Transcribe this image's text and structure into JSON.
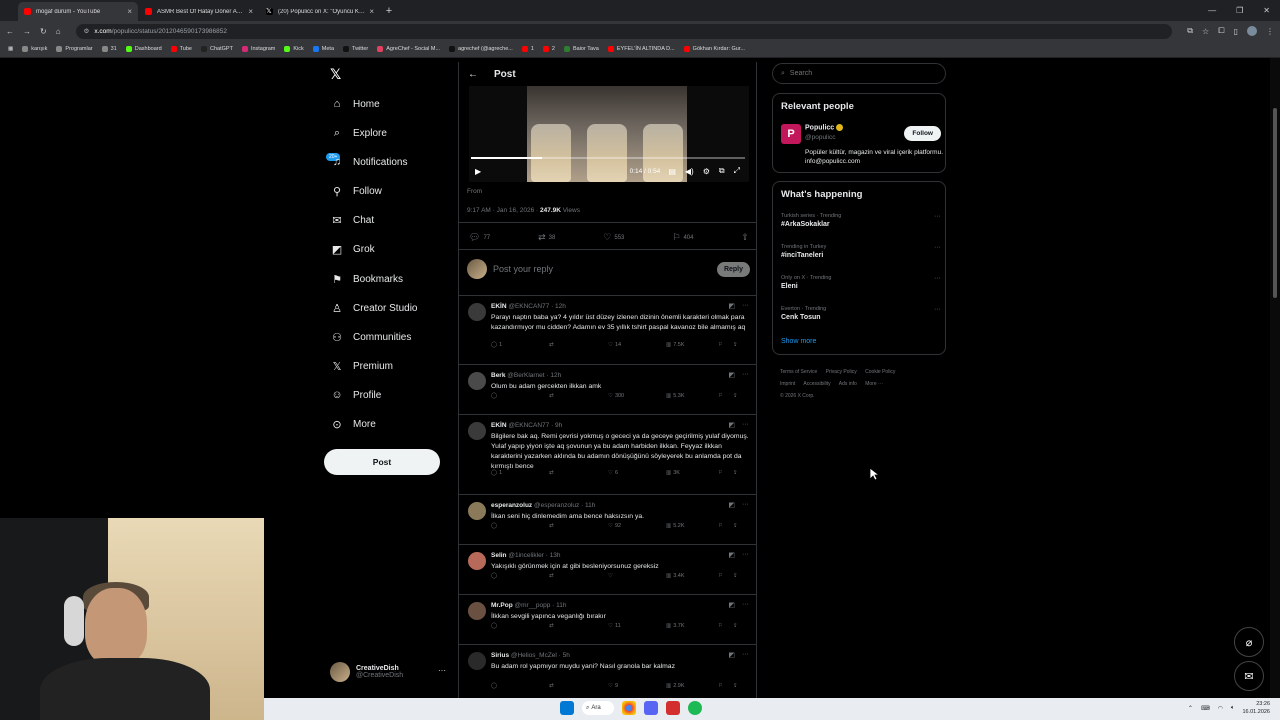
{
  "browser": {
    "tabs": [
      {
        "title": "mogaf dürüm - YouTube",
        "icon": "youtube-icon",
        "color": "#ff0000"
      },
      {
        "title": "ASMR Best Of Hatay Döner Ac...",
        "icon": "youtube-icon",
        "color": "#ff0000"
      },
      {
        "title": "(20) Populicc on X: \"Oyuncu Kı...",
        "icon": "x-icon",
        "color": "#ffffff"
      }
    ],
    "url_main": "x.com",
    "url_rest": "/populicc/status/2012046590173986852",
    "bookmarks": [
      "karışık",
      "Programlar",
      "31",
      "Dashboard",
      "Tube",
      "ChatGPT",
      "Instagram",
      "Kick",
      "Meta",
      "Twitter",
      "AgreChef - Social M...",
      "agrechef (@agreche...",
      "1",
      "2",
      "Baior Tava",
      "EYFEL'İN ALTINDA D...",
      "Gökhan Kırdar: Gur..."
    ]
  },
  "nav": {
    "items": [
      {
        "label": "Home",
        "icon": "home-icon",
        "glyph": "⌂"
      },
      {
        "label": "Explore",
        "icon": "search-icon",
        "glyph": "⌕"
      },
      {
        "label": "Notifications",
        "icon": "bell-icon",
        "glyph": "🔔"
      },
      {
        "label": "Follow",
        "icon": "add-person-icon",
        "glyph": "👤"
      },
      {
        "label": "Chat",
        "icon": "mail-icon",
        "glyph": "✉"
      },
      {
        "label": "Grok",
        "icon": "grok-icon",
        "glyph": "◩"
      },
      {
        "label": "Bookmarks",
        "icon": "bookmark-icon",
        "glyph": "⚑"
      },
      {
        "label": "Creator Studio",
        "icon": "creator-studio-icon",
        "glyph": "♙"
      },
      {
        "label": "Communities",
        "icon": "communities-icon",
        "glyph": "👥"
      },
      {
        "label": "Premium",
        "icon": "x-premium-icon",
        "glyph": "𝕏"
      },
      {
        "label": "Profile",
        "icon": "profile-icon",
        "glyph": "👤"
      },
      {
        "label": "More",
        "icon": "more-circle-icon",
        "glyph": "⋯"
      }
    ],
    "badge": "20+",
    "post_label": "Post",
    "account_name": "CreativeDish",
    "account_handle": "@CreativeDish"
  },
  "post": {
    "header": "Post",
    "video_time": "0:14 / 0:54",
    "video_progress": 0.26,
    "from": "From",
    "time": "9:17 AM · Jan 16, 2026 · ",
    "views_count": "247.9K",
    "views_label": " Views",
    "replies": "77",
    "reposts": "38",
    "likes": "553",
    "bookmarks": "404",
    "reply_placeholder": "Post your reply",
    "reply_button": "Reply"
  },
  "replies": [
    {
      "name": "EKİN",
      "handle": "@EKNCAN77 · 12h",
      "text": "Parayı naptın baba ya? 4 yıldır üst düzey izlenen dizinin önemli karakteri olmak para kazandırmıyor mu cidden? Adamın ev 35 yıllık tshirt paspal kavanoz bile almamış aq",
      "replies": "1",
      "reposts": "",
      "likes": "14",
      "views": "7.5K",
      "avatar": "#3a3a3a"
    },
    {
      "name": "Berk",
      "handle": "@BerKlarnet · 12h",
      "text": "Olum bu adam gercekten ilkkan amk",
      "replies": "",
      "reposts": "",
      "likes": "300",
      "views": "5.3K",
      "avatar": "#4a4a4a"
    },
    {
      "name": "EKİN",
      "handle": "@EKNCAN77 · 9h",
      "text": "Bilgilere bak aq. Remi çevrisi yokmuş o gececi ya da geceye geçirilmiş yulaf diyomuş. Yulaf yapıp yiyon işte aq şovunun ya bu adam harbiden ilkkan. Feyyaz ilkkan karakterini yazarken aklında bu adamın dönüşüğünü söyleyerek bu anlamda pot da kırmıştı bence",
      "replies": "1",
      "reposts": "",
      "likes": "6",
      "views": "3K",
      "avatar": "#3a3a3a"
    },
    {
      "name": "esperanzoluz",
      "handle": "@esperanzoluz · 11h",
      "text": "İlkan seni hiç dinlemedim ama bence haksızsın ya.",
      "replies": "",
      "reposts": "",
      "likes": "92",
      "views": "5.2K",
      "avatar": "#8a7a5a"
    },
    {
      "name": "Selin",
      "handle": "@1incelikler · 13h",
      "text": "Yakışıklı görünmek için at gibi besleniyorsunuz gereksiz",
      "replies": "",
      "reposts": "",
      "likes": "",
      "views": "3.4K",
      "avatar": "#b86a5a"
    },
    {
      "name": "Mr.Pop",
      "handle": "@mr__popp · 11h",
      "text": "İlkkan sevgili yapınca veganlığı bırakır",
      "replies": "",
      "reposts": "",
      "likes": "11",
      "views": "3.7K",
      "avatar": "#6a5040"
    },
    {
      "name": "Sirius",
      "handle": "@Helios_McZel · 5h",
      "text": "Bu adam rol yapmıyor muydu yani? Nasıl granola bar kalmaz",
      "replies": "",
      "reposts": "",
      "likes": "9",
      "views": "2.9K",
      "avatar": "#2a2a2a"
    }
  ],
  "right": {
    "search_placeholder": "Search",
    "relevant_title": "Relevant people",
    "person_name": "Populicc",
    "person_handle": "@populicc",
    "person_bio": "Popüler kültür, magazin ve viral içerik platformu. info@populicc.com",
    "follow_label": "Follow",
    "happening_title": "What's happening",
    "trends": [
      {
        "category": "Turkish series · Trending",
        "title": "#ArkaSokaklar"
      },
      {
        "category": "Trending in Turkey",
        "title": "#inciTaneleri"
      },
      {
        "category": "Only on X · Trending",
        "title": "Eleni"
      },
      {
        "category": "Everton · Trending",
        "title": "Cenk Tosun"
      }
    ],
    "show_more": "Show more",
    "footer": [
      "Terms of Service",
      "Privacy Policy",
      "Cookie Policy",
      "Imprint",
      "Accessibility",
      "Ads info",
      "More ···",
      "© 2026 X Corp."
    ]
  },
  "taskbar": {
    "search_label": "Ara",
    "time": "23:26",
    "date": "16.01.2026"
  }
}
